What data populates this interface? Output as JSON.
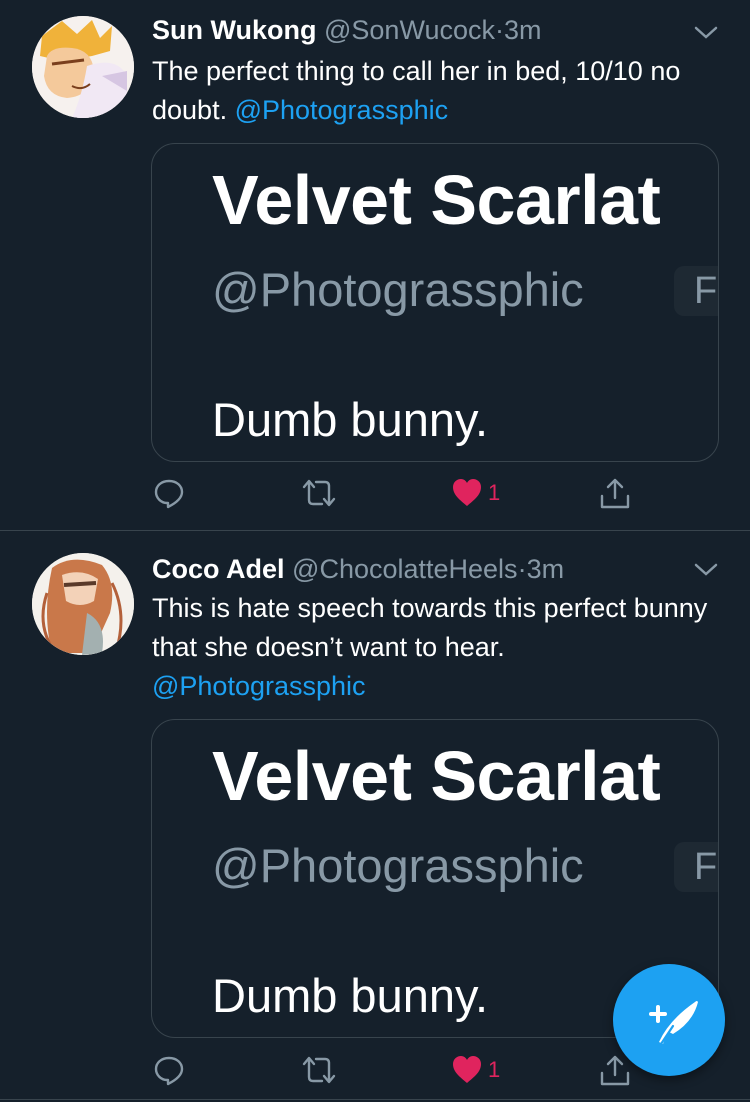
{
  "tweets": [
    {
      "name": "Sun Wukong",
      "handle": "@SonWucock",
      "sep": "·",
      "time": "3m",
      "text": "The perfect thing to call her in bed, 10/10 no doubt. ",
      "mention": "@Photograssphic",
      "card": {
        "name": "Velvet Scarlat",
        "handle": "@Photograssphic",
        "follow_letter": "F",
        "text": "Dumb bunny."
      },
      "likes": "1"
    },
    {
      "name": "Coco Adel",
      "handle": "@ChocolatteHeels",
      "sep": "·",
      "time": "3m",
      "text": "This is hate speech towards this perfect bunny that she doesn’t want to hear.",
      "mention": "@Photograssphic",
      "card": {
        "name": "Velvet Scarlat",
        "handle": "@Photograssphic",
        "follow_letter": "F",
        "text": "Dumb bunny."
      },
      "likes": "1"
    }
  ],
  "icons": {
    "reply": "reply-icon",
    "retweet": "retweet-icon",
    "like": "heart-icon",
    "share": "share-icon",
    "compose": "compose-tweet-icon",
    "more": "chevron-down-icon"
  },
  "colors": {
    "background": "#15202b",
    "accent": "#1da1f2",
    "like": "#e0245e",
    "muted": "#8899a6",
    "border": "#38444d"
  }
}
